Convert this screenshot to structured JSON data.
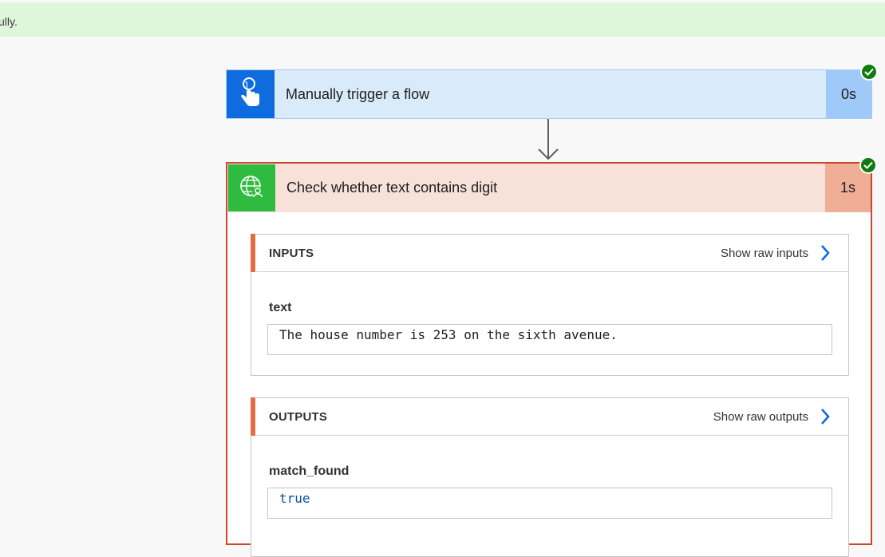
{
  "banner": {
    "text": "ully."
  },
  "trigger": {
    "title": "Manually trigger a flow",
    "duration": "0s",
    "icon": "touch-hand-icon",
    "status": "succeeded"
  },
  "action": {
    "title": "Check whether text contains digit",
    "duration": "1s",
    "icon": "globe-user-icon",
    "status": "succeeded",
    "inputs": {
      "label": "INPUTS",
      "raw_link": "Show raw inputs",
      "field_name": "text",
      "field_value": "The house number is 253 on the sixth avenue."
    },
    "outputs": {
      "label": "OUTPUTS",
      "raw_link": "Show raw outputs",
      "field_name": "match_found",
      "field_value": "true"
    }
  },
  "colors": {
    "banner_bg": "#dff6dd",
    "trigger_accent": "#0f6cdf",
    "action_accent": "#2ebb3f",
    "action_border": "#c9472c",
    "success": "#107c10",
    "link_chevron": "#0f6cdf",
    "output_value": "#0b4fa3"
  }
}
